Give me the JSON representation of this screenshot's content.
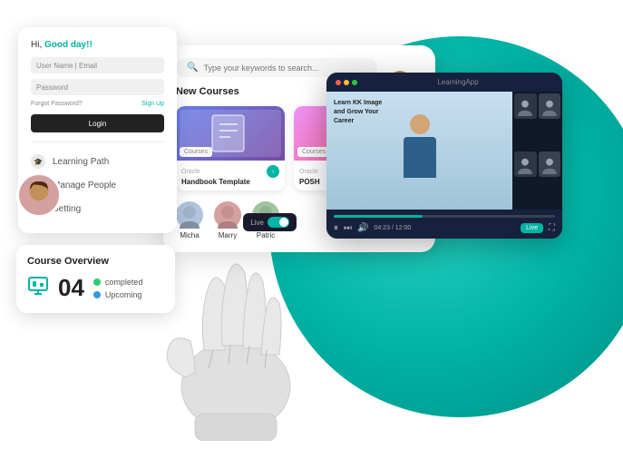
{
  "background": {
    "teal_color": "#00b4a6"
  },
  "login_card": {
    "greeting": "Hi, Good day!!",
    "greeting_highlight": "Good day!!",
    "username_placeholder": "User Name | Email",
    "password_placeholder": "Password",
    "forgot_password": "Forgot Password?",
    "sign_up": "Sign Up",
    "login_button": "Login"
  },
  "nav": {
    "items": [
      {
        "label": "Learning Path",
        "icon": "🎓"
      },
      {
        "label": "Manage People",
        "icon": "👥"
      },
      {
        "label": "Setting",
        "icon": "⚙"
      }
    ]
  },
  "course_overview": {
    "title": "Course Overview",
    "count": "04",
    "completed_label": "completed",
    "upcoming_label": "Upcoming"
  },
  "dashboard": {
    "search_placeholder": "Type your keywords to search...",
    "new_courses_title": "New Courses",
    "courses": [
      {
        "label": "Courses",
        "sublabel": "Oracle",
        "title": "Handbook Template"
      },
      {
        "label": "Courses",
        "sublabel": "Oracle",
        "title": "POSH"
      }
    ],
    "people": [
      {
        "name": "Micha",
        "color": "#b0c4de"
      },
      {
        "name": "Marry",
        "color": "#d4a0a0"
      },
      {
        "name": "Patric",
        "color": "#a0c4a0"
      }
    ]
  },
  "video_player": {
    "title": "Learn KK Image and Grow Your Career",
    "progress_time": "04:23 / 12:00",
    "live_button": "Live"
  }
}
